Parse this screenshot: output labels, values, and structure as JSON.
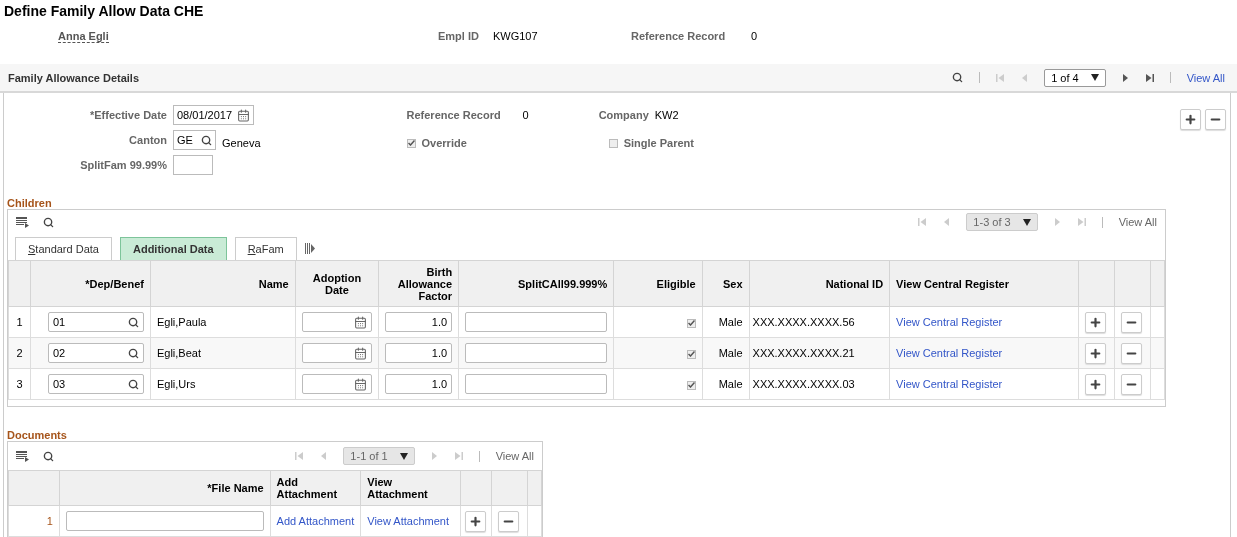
{
  "page_title": "Define Family Allow Data CHE",
  "header": {
    "employee_name": "Anna Egli",
    "empl_id_label": "Empl ID",
    "empl_id": "KWG107",
    "reference_record_label": "Reference Record",
    "reference_record": "0"
  },
  "section": {
    "title": "Family Allowance Details",
    "pager": "1 of 4",
    "view_all": "View All"
  },
  "form": {
    "effective_date_label": "*Effective Date",
    "effective_date": "08/01/2017",
    "canton_label": "Canton",
    "canton": "GE",
    "canton_name": "Geneva",
    "splitfam_label": "SplitFam 99.99%",
    "reference_record_label": "Reference Record",
    "reference_record": "0",
    "company_label": "Company",
    "company": "KW2",
    "checkboxes": [
      {
        "label": "Override",
        "checked": true
      },
      {
        "label": "Single Parent",
        "checked": false
      }
    ]
  },
  "children": {
    "title": "Children",
    "pager": "1-3 of 3",
    "view_all": "View All",
    "tabs": [
      {
        "label": "Standard Data",
        "selected": false
      },
      {
        "label": "Additional Data",
        "selected": true
      },
      {
        "label": "RaFam",
        "selected": false
      }
    ],
    "columns": [
      "*Dep/Benef",
      "Name",
      "Adoption Date",
      "Birth Allowance Factor",
      "SplitCAll99.999%",
      "Eligible",
      "Sex",
      "National ID",
      "View Central Register"
    ],
    "rows": [
      {
        "number": "1",
        "dep": "01",
        "name": "Egli,Paula",
        "factor": "1.0",
        "eligible": true,
        "sex": "Male",
        "national_id": "XXX.XXXX.XXXX.56",
        "link": "View Central Register"
      },
      {
        "number": "2",
        "dep": "02",
        "name": "Egli,Beat",
        "factor": "1.0",
        "eligible": true,
        "sex": "Male",
        "national_id": "XXX.XXXX.XXXX.21",
        "link": "View Central Register"
      },
      {
        "number": "3",
        "dep": "03",
        "name": "Egli,Urs",
        "factor": "1.0",
        "eligible": true,
        "sex": "Male",
        "national_id": "XXX.XXXX.XXXX.03",
        "link": "View Central Register"
      }
    ]
  },
  "documents": {
    "title": "Documents",
    "pager": "1-1 of 1",
    "view_all": "View All",
    "columns": [
      "*File Name",
      "Add Attachment",
      "View Attachment"
    ],
    "rows": [
      {
        "number": "1",
        "add": "Add Attachment",
        "view": "View Attachment"
      }
    ]
  }
}
